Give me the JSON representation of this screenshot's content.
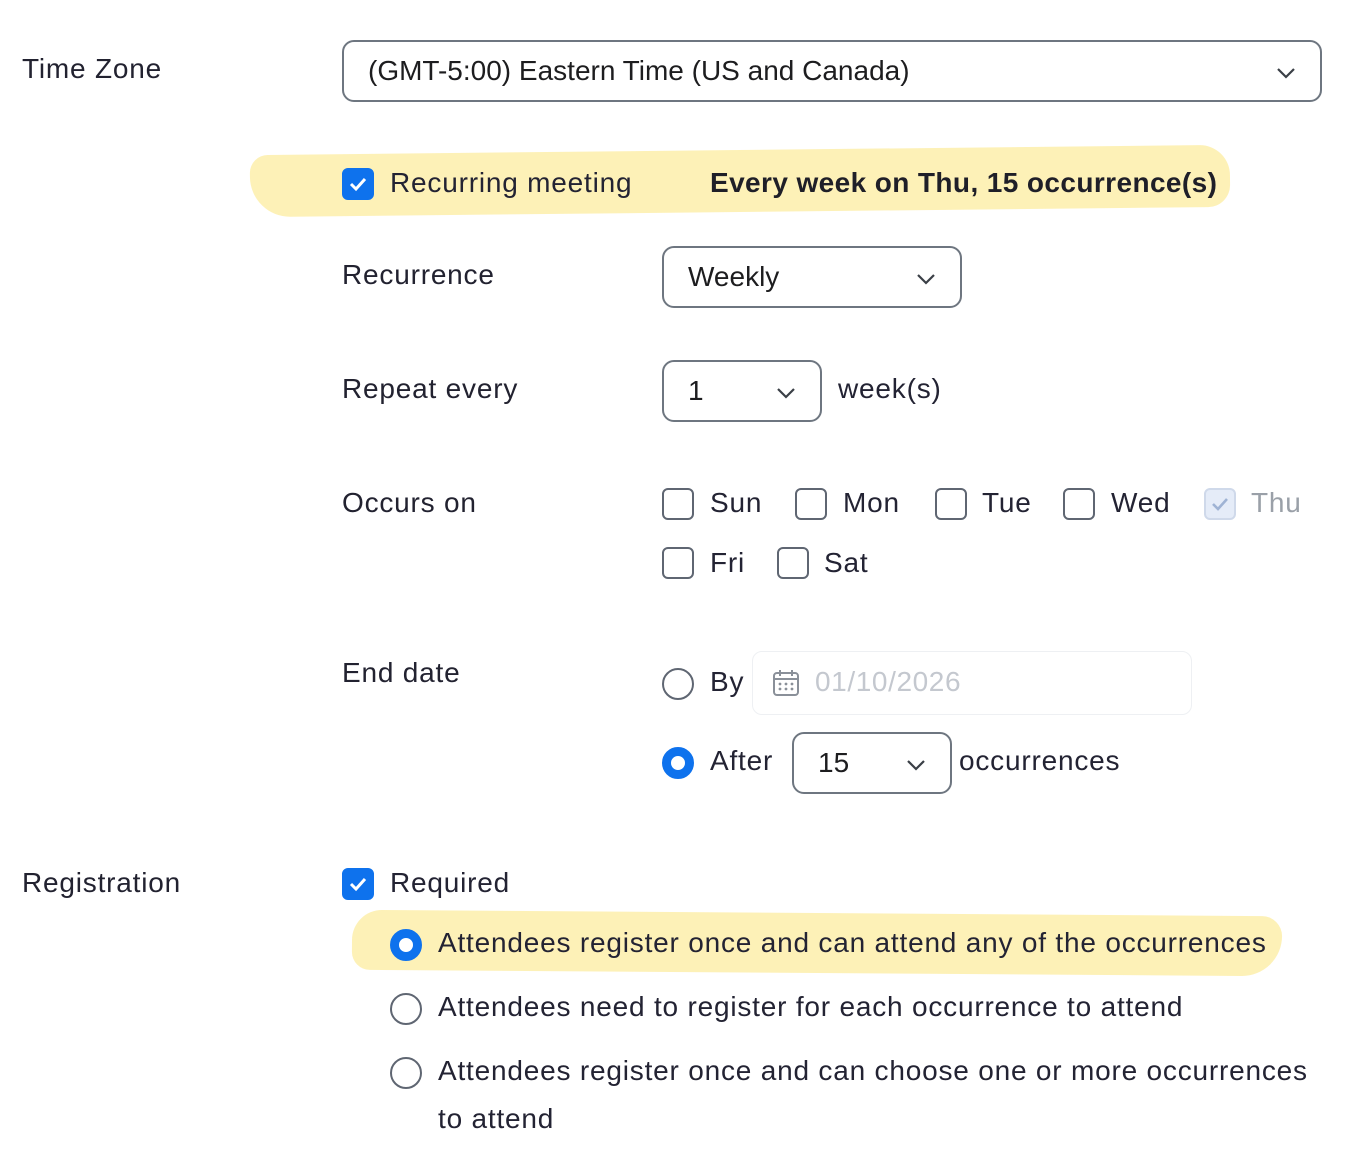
{
  "time_zone": {
    "label": "Time Zone",
    "value": "(GMT-5:00) Eastern Time (US and Canada)"
  },
  "recurring": {
    "label": "Recurring meeting",
    "checked": true,
    "summary": "Every week on Thu, 15 occurrence(s)"
  },
  "recurrence": {
    "label": "Recurrence",
    "value": "Weekly"
  },
  "repeat_every": {
    "label": "Repeat every",
    "value": "1",
    "unit": "week(s)"
  },
  "occurs_on": {
    "label": "Occurs on",
    "days": [
      {
        "label": "Sun",
        "checked": false
      },
      {
        "label": "Mon",
        "checked": false
      },
      {
        "label": "Tue",
        "checked": false
      },
      {
        "label": "Wed",
        "checked": false
      },
      {
        "label": "Thu",
        "checked": true,
        "disabled": true
      },
      {
        "label": "Fri",
        "checked": false
      },
      {
        "label": "Sat",
        "checked": false
      }
    ]
  },
  "end_date": {
    "label": "End date",
    "by_label": "By",
    "by_date_placeholder": "01/10/2026",
    "after_label": "After",
    "after_value": "15",
    "after_unit": "occurrences",
    "selected": "after"
  },
  "registration": {
    "label": "Registration",
    "required_label": "Required",
    "required_checked": true,
    "options": [
      {
        "label": "Attendees register once and can attend any of the occurrences",
        "selected": true
      },
      {
        "label": "Attendees need to register for each occurrence to attend",
        "selected": false
      },
      {
        "label": "Attendees register once and can choose one or more occurrences",
        "label_line2": "to attend",
        "selected": false
      }
    ]
  },
  "colors": {
    "accent": "#0e72ed",
    "highlight": "#fdeeaa"
  }
}
